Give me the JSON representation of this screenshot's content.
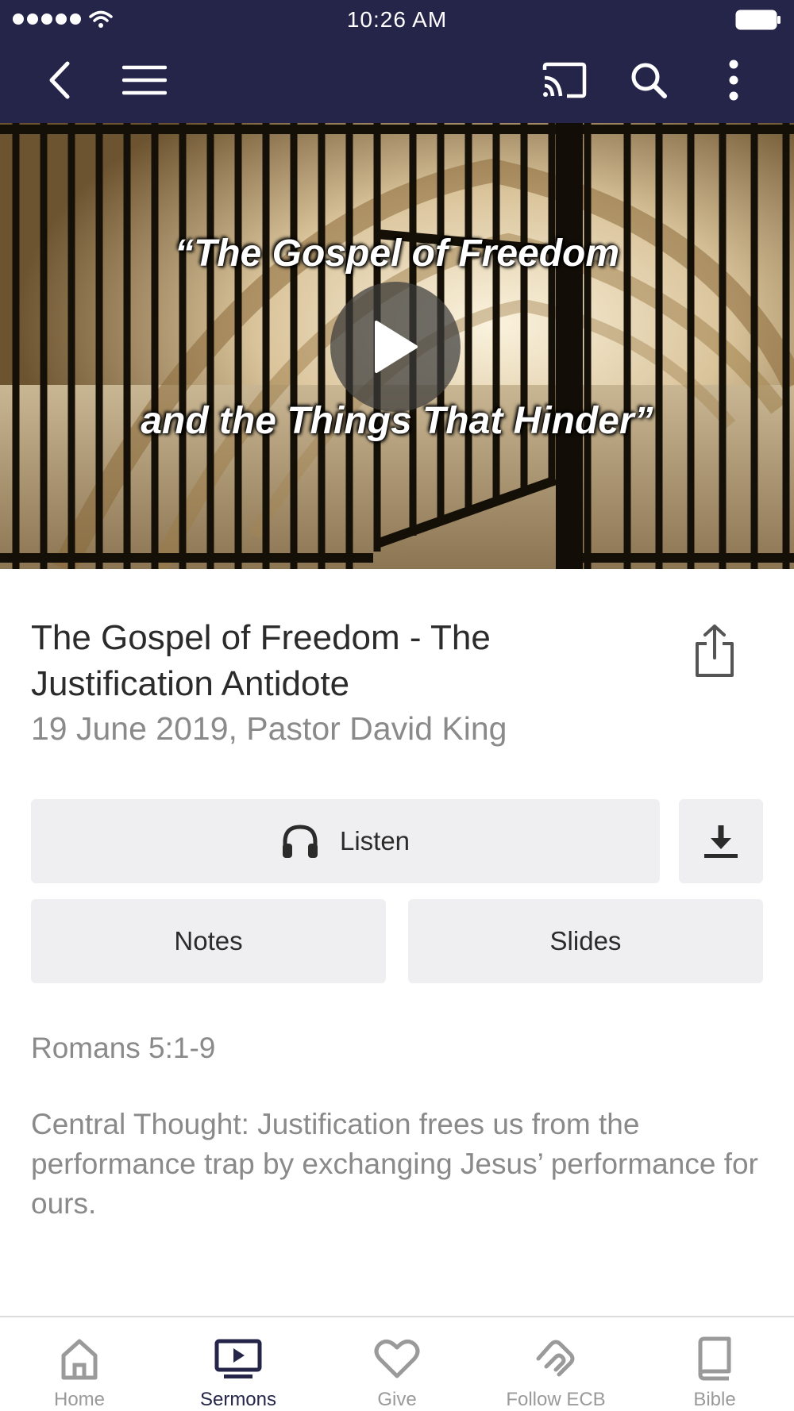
{
  "status_bar": {
    "time": "10:26 AM"
  },
  "app_bar": {
    "icons": [
      "back-icon",
      "menu-icon",
      "cast-icon",
      "search-icon",
      "more-icon"
    ]
  },
  "video": {
    "title_line1": "“The Gospel of Freedom",
    "title_line2": "and the Things That Hinder”",
    "icon": "play-icon"
  },
  "sermon": {
    "title": "The Gospel of Freedom - The Justification Antidote",
    "subtitle": "19 June 2019, Pastor David King",
    "scripture": "Romans 5:1-9",
    "central_thought": "Central Thought:  Justification frees us from the performance trap by exchanging Jesus’ performance for ours."
  },
  "actions": {
    "listen": "Listen",
    "notes": "Notes",
    "slides": "Slides"
  },
  "tabs": [
    {
      "label": "Home",
      "icon": "home-icon",
      "active": false
    },
    {
      "label": "Sermons",
      "icon": "sermons-icon",
      "active": true
    },
    {
      "label": "Give",
      "icon": "heart-icon",
      "active": false
    },
    {
      "label": "Follow ECB",
      "icon": "follow-icon",
      "active": false
    },
    {
      "label": "Bible",
      "icon": "book-icon",
      "active": false
    }
  ],
  "colors": {
    "header": "#25254a",
    "button_bg": "#efeff1",
    "muted_text": "#8a8a8a",
    "tab_inactive": "#9a9a9a",
    "tab_active": "#25254a"
  }
}
